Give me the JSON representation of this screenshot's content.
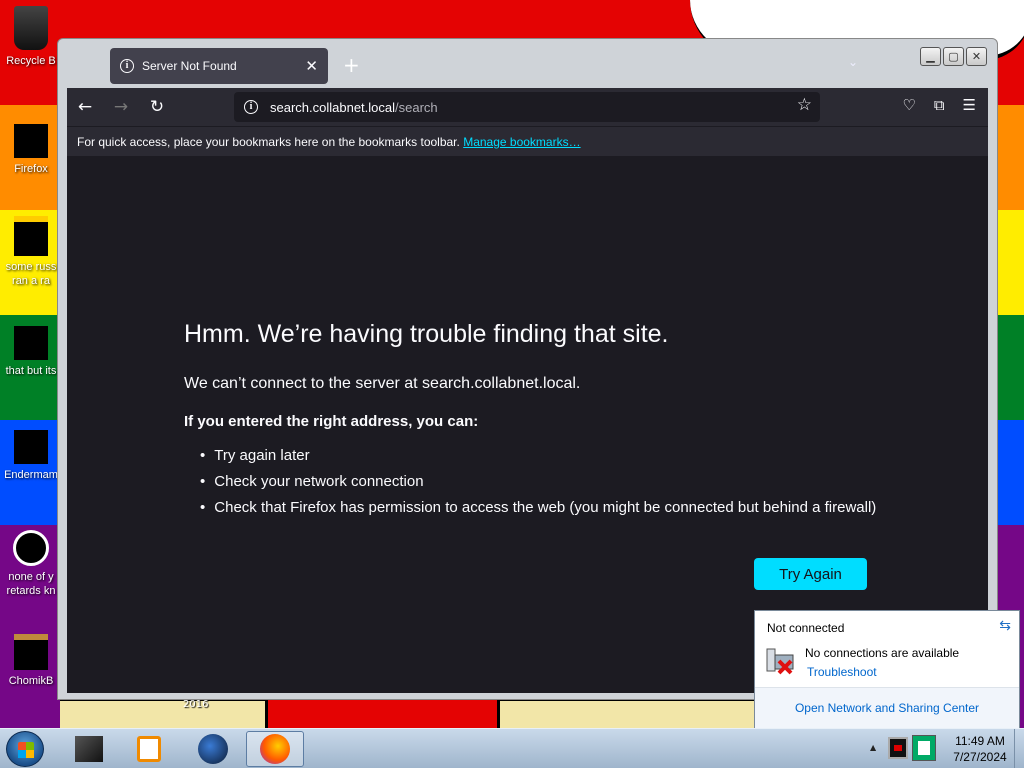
{
  "desktop": {
    "icons": [
      {
        "label": "Recycle B",
        "icon": "recycle-bin-icon"
      },
      {
        "label": "Firefox",
        "icon": "firefox-icon"
      },
      {
        "label": "some russ",
        "label2": "ran a ra",
        "icon": "file-icon"
      },
      {
        "label": "that but its",
        "icon": "folder-icon"
      },
      {
        "label": "Endermam",
        "icon": "window-icon"
      },
      {
        "label": "none of y",
        "label2": "retards kn",
        "icon": "app-icon"
      },
      {
        "label": "ChomikB",
        "icon": "hamster-icon"
      }
    ],
    "wallpaper_text": "2016"
  },
  "browser": {
    "tab": {
      "title": "Server Not Found",
      "icon": "info-icon"
    },
    "new_tab_label": "+",
    "url": {
      "host": "search.collabnet.local",
      "path": "/search"
    },
    "bookmarks_bar": {
      "text": "For quick access, place your bookmarks here on the bookmarks toolbar.",
      "link": "Manage bookmarks…"
    },
    "error": {
      "title": "Hmm. We’re having trouble finding that site.",
      "description": "We can’t connect to the server at search.collabnet.local.",
      "hint": "If you entered the right address, you can:",
      "suggestions": [
        "Try again later",
        "Check your network connection",
        "Check that Firefox has permission to access the web (you might be connected but behind a firewall)"
      ],
      "button": "Try Again"
    }
  },
  "network_flyout": {
    "status": "Not connected",
    "message": "No connections are available",
    "troubleshoot": "Troubleshoot",
    "footer_link": "Open Network and Sharing Center"
  },
  "taskbar": {
    "time": "11:49 AM",
    "date": "7/27/2024"
  },
  "colors": {
    "accent": "#00ddff",
    "content_bg": "#1c1b22",
    "toolbar_bg": "#2b2a33",
    "tab_bg": "#42414d"
  }
}
